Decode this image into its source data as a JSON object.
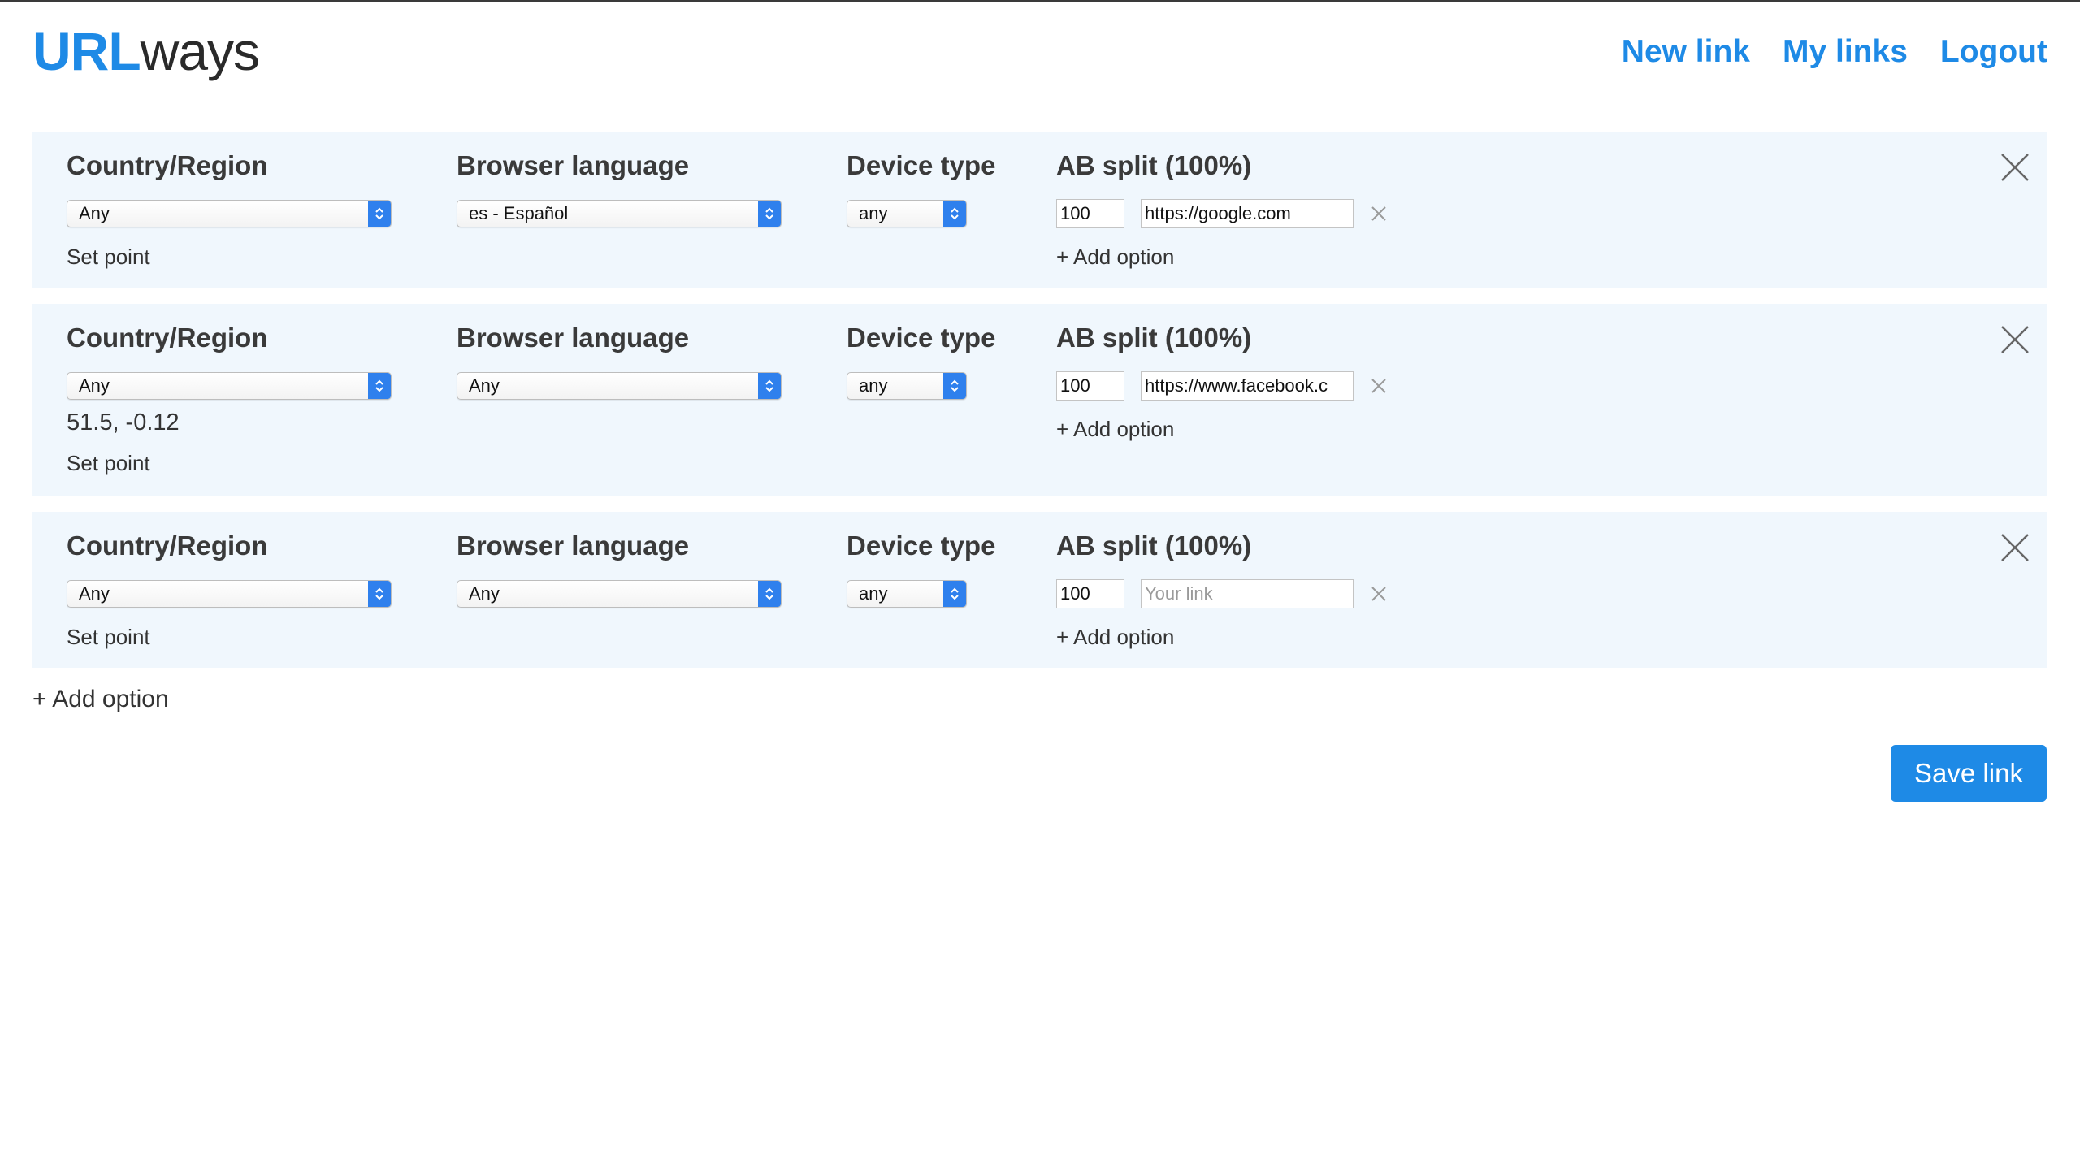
{
  "brand": {
    "part1": "URL",
    "part2": "ways"
  },
  "nav": {
    "new_link": "New link",
    "my_links": "My links",
    "logout": "Logout"
  },
  "labels": {
    "country": "Country/Region",
    "language": "Browser language",
    "device": "Device type",
    "ab": "AB split (100%)",
    "set_point": "Set point",
    "add_option": "+ Add option"
  },
  "rules": [
    {
      "country": "Any",
      "language": "es - Español",
      "device": "any",
      "coords": "",
      "split": "100",
      "url": "https://google.com",
      "url_placeholder": "Your link"
    },
    {
      "country": "Any",
      "language": "Any",
      "device": "any",
      "coords": "51.5, -0.12",
      "split": "100",
      "url": "https://www.facebook.c",
      "url_placeholder": "Your link"
    },
    {
      "country": "Any",
      "language": "Any",
      "device": "any",
      "coords": "",
      "split": "100",
      "url": "",
      "url_placeholder": "Your link"
    }
  ],
  "footer": {
    "add_option": "+ Add option",
    "save": "Save link"
  },
  "colors": {
    "accent": "#1e8ae6",
    "panel": "#f0f7fd",
    "select_arrow": "#2f80ed"
  }
}
